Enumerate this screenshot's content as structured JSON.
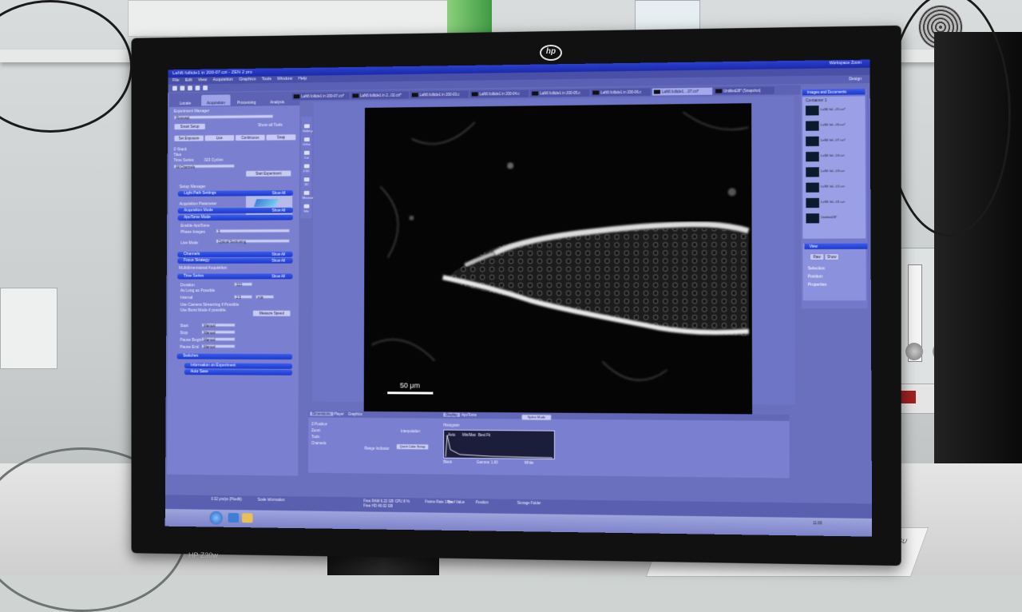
{
  "monitor": {
    "brand_logo": "hp",
    "model_label": "HP Z30w"
  },
  "app": {
    "title": "LaN6 follicle1 in 200-07.czi - ZEN 2 pro",
    "workspace_label": "Workspace Zoom",
    "design_label": "Design",
    "menu": [
      "File",
      "Edit",
      "View",
      "Acquisition",
      "Graphics",
      "Tools",
      "Window",
      "Help"
    ]
  },
  "left_tabs": [
    "Locate",
    "Acquisition",
    "Processing",
    "Analysis"
  ],
  "left_panel": {
    "experiment_manager": "Experiment Manager",
    "experiment_select": "Renewal",
    "smart_setup": "Smart Setup",
    "show_all_tools": "Show all Tools",
    "buttons": [
      "Set Exposure",
      "Live",
      "Continuous",
      "Snap"
    ],
    "options": [
      "Z-Stack",
      "Tiles",
      "Time Series"
    ],
    "time_series_value": "323 Cycles",
    "all_channels": "All Channels",
    "start_experiment": "Start Experiment",
    "setup_manager": "Setup Manager",
    "light_path_settings": "Light Path Settings",
    "acquisition_parameter": "Acquisition Parameter",
    "acquisition_mode": "Acquisition Mode",
    "apotome_mode": "ApoTome Mode",
    "enable_apotome": "Enable ApoTome",
    "phase_images": "Phase Images",
    "phase_images_value": "5",
    "live_mode": "Live Mode",
    "live_mode_value": "Optical Sectioning",
    "channels": "Channels",
    "focus_strategy": "Focus Strategy",
    "multidimensional_acquisition": "Multidimensional Acquisition",
    "time_series": "Time Series",
    "duration": "Duration",
    "duration_value": "323",
    "as_long_as_possible": "As Long as Possible",
    "interval": "Interval",
    "interval_value": "2.5",
    "interval_unit": "min",
    "use_camera_streaming": "Use Camera Streaming if Possible",
    "use_burst_mode": "Use Burst Mode if possible",
    "measure_speed": "Measure Speed",
    "start": "Start",
    "stop": "Stop",
    "pause_begin": "Pause Begin",
    "pause_end": "Pause End",
    "manual": "Manual",
    "switches": "Switches",
    "information_on_experiment": "Information on Experiment",
    "auto_save": "Auto Save",
    "show_all": "Show All"
  },
  "side_icons": [
    "Gallery",
    "Ortho",
    "Cut",
    "2.5D",
    "3D",
    "Measure",
    "Info"
  ],
  "doc_tabs": [
    "LaN6 follicle1 in 200-07.czi*",
    "LaN6 follicle1 in 2...02.czi*",
    "LaN6 follicle1 in 200-03.c",
    "LaN6 follicle1 in 200-04.c",
    "LaN6 follicle1 in 200-05.c",
    "LaN6 follicle1 in 200-06.c",
    "LaN6 follicle1 ...07.czi*",
    "Untitled28* (Snapshot)"
  ],
  "image": {
    "scale_label": "50 μm"
  },
  "right_panel": {
    "header": "Images and Documents",
    "container": "Container 1",
    "view_header": "View",
    "view_items": [
      "Selection",
      "Position",
      "Properties"
    ],
    "view_buttons": [
      "Raw",
      "Show"
    ],
    "items": [
      "LaN6 fol...05.czi*",
      "LaN6 fol...06.czi*",
      "LaN6 fol...07.czi*",
      "LaN6 fol...04.czi",
      "LaN6 fol...03.czi",
      "LaN6 fol...02.czi",
      "LaN6 fol...01.czi",
      "Untitled28*"
    ]
  },
  "bottom": {
    "tabs": [
      "Dimensions",
      "Player",
      "Graphics"
    ],
    "right_tabs": [
      "Display",
      "ApoTome"
    ],
    "z_position_label": "Z-Position",
    "zoom_label": "Zoom",
    "tools_label": "Tools",
    "channels_label": "Channels",
    "interpolation": "Interpolation",
    "range_indicator": "Range Indicator",
    "quick_color_setup": "Quick Color Setup",
    "histogram": "Histogram",
    "auto": "Auto",
    "min_max": "Min/Max",
    "best_fit": "Best Fit",
    "spline_mode": "Spline Mode",
    "black_label": "Black",
    "gamma_label": "Gamma",
    "white_label": "White",
    "gamma_value": "1.00"
  },
  "statusbar": {
    "scale": "0.32 μm/px (Pixelfit)",
    "scale_info": "Scale Information",
    "free_ram": "Free RAM 6.22 GB",
    "free_hdd": "Free HD 40.02 GB",
    "cpu": "CPU 8 %",
    "frame_rate": "Frame Rate 1 fps",
    "pixel_value": "Pixel Value",
    "position": "Position",
    "storage_folder": "Storage Folder"
  },
  "taskbar": {
    "clock": "11:06"
  },
  "colors": {
    "ui_base": "#7a80cf",
    "accent_blue": "#1c38c8",
    "title_blue": "#2c3fd0"
  }
}
